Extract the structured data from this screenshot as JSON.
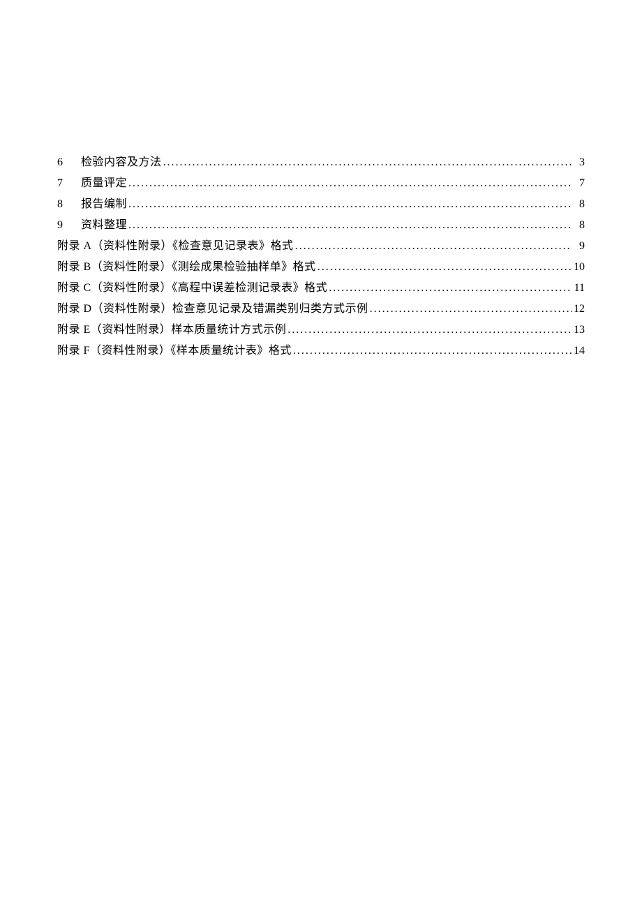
{
  "toc": {
    "numbered": [
      {
        "num": "6",
        "label": "检验内容及方法",
        "page": "3"
      },
      {
        "num": "7",
        "label": "质量评定",
        "page": "7"
      },
      {
        "num": "8",
        "label": "报告编制",
        "page": "8"
      },
      {
        "num": "9",
        "label": "资料整理",
        "page": "8"
      }
    ],
    "appendices": [
      {
        "label": "附录 A（资料性附录）《检查意见记录表》格式",
        "page": "9"
      },
      {
        "label": "附录 B（资料性附录）《测绘成果检验抽样单》格式",
        "page": "10"
      },
      {
        "label": "附录 C（资料性附录）《高程中误差检测记录表》格式",
        "page": "11"
      },
      {
        "label": "附录 D（资料性附录）检查意见记录及错漏类别归类方式示例",
        "page": "12"
      },
      {
        "label": "附录 E（资料性附录）样本质量统计方式示例",
        "page": "13"
      },
      {
        "label": "附录 F（资料性附录）《样本质量统计表》格式",
        "page": "14"
      }
    ]
  }
}
